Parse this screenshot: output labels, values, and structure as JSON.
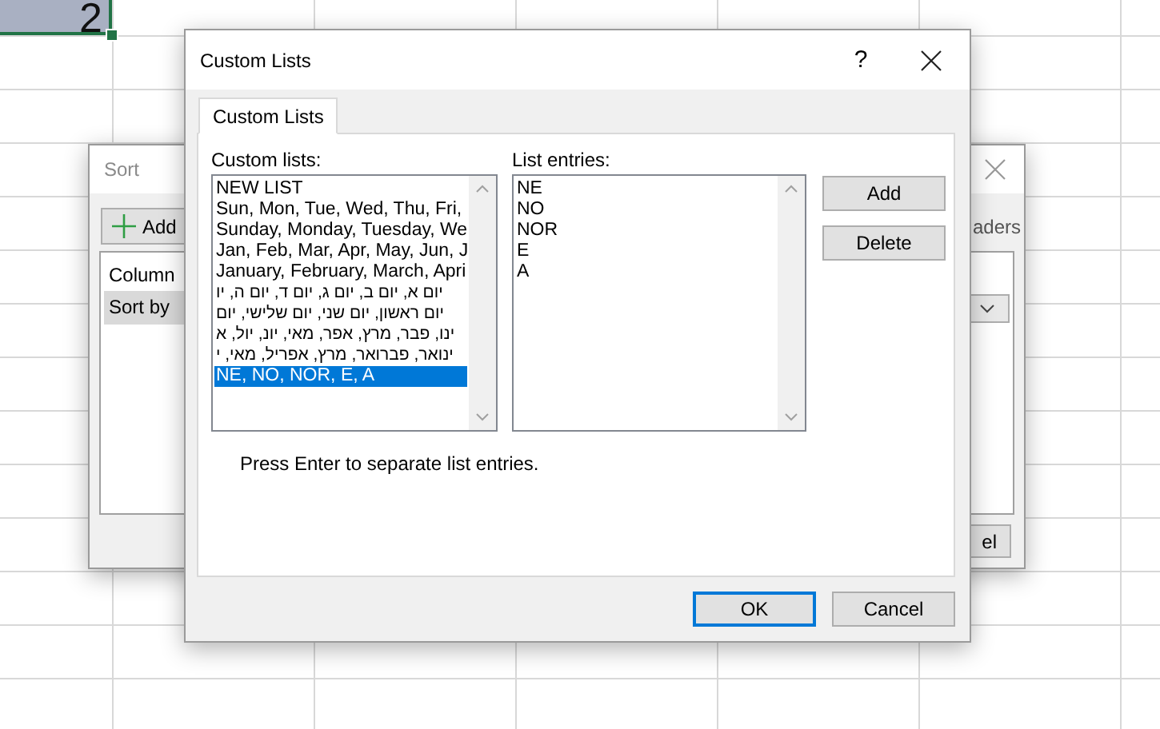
{
  "spreadsheet": {
    "active_cell": "2"
  },
  "sort_dialog": {
    "title": "Sort",
    "add_button": "Add",
    "headers_label": "aders",
    "column_header": "Column",
    "row_label": "Sort by",
    "cancel_button": "el"
  },
  "custom_lists_dialog": {
    "title": "Custom Lists",
    "help": "?",
    "tabs": [
      {
        "label": "Custom Lists",
        "selected": true
      }
    ],
    "custom_lists_label": "Custom lists:",
    "custom_lists": [
      {
        "text": "NEW LIST",
        "selected": false
      },
      {
        "text": "Sun, Mon, Tue, Wed, Thu, Fri,",
        "selected": false
      },
      {
        "text": "Sunday, Monday, Tuesday, We",
        "selected": false
      },
      {
        "text": "Jan, Feb, Mar, Apr, May, Jun, J",
        "selected": false
      },
      {
        "text": "January, February, March, Apri",
        "selected": false
      },
      {
        "text": "יום א, יום ב, יום ג, יום ד, יום ה, יו",
        "selected": false
      },
      {
        "text": "יום ראשון, יום שני, יום שלישי, יום",
        "selected": false
      },
      {
        "text": "ינו, פבר, מרץ, אפר, מאי, יונ, יול, א",
        "selected": false
      },
      {
        "text": "ינואר, פברואר, מרץ, אפריל, מאי, י",
        "selected": false
      },
      {
        "text": "NE, NO, NOR, E, A",
        "selected": true
      }
    ],
    "entries_label": "List entries:",
    "entries": [
      "NE",
      "NO",
      "NOR",
      "E",
      "A"
    ],
    "add_button": "Add",
    "delete_button": "Delete",
    "hint": "Press Enter to separate list entries.",
    "ok_button": "OK",
    "cancel_button": "Cancel"
  }
}
